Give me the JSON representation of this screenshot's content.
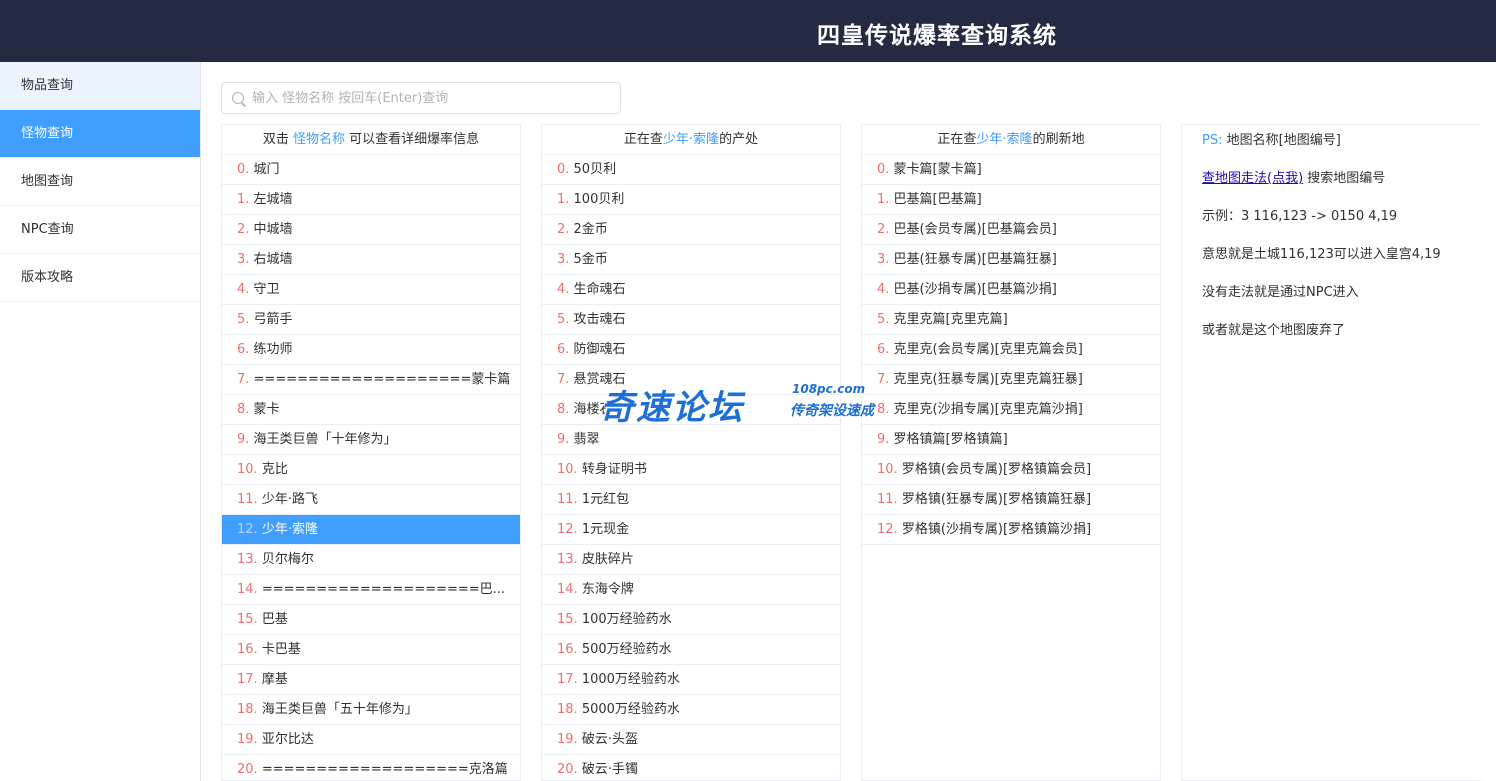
{
  "header": {
    "title": "四皇传说爆率查询系统"
  },
  "sidebar": {
    "items": [
      {
        "label": "物品查询"
      },
      {
        "label": "怪物查询"
      },
      {
        "label": "地图查询"
      },
      {
        "label": "NPC查询"
      },
      {
        "label": "版本攻略"
      }
    ],
    "active_index": 1
  },
  "search": {
    "placeholder": "输入 怪物名称 按回车(Enter)查询",
    "value": ""
  },
  "monster_panel": {
    "head_prefix": "双击 ",
    "head_highlight": "怪物名称",
    "head_suffix": " 可以查看详细爆率信息",
    "selected_index": 12,
    "rows": [
      {
        "idx": "0.",
        "text": " 城门"
      },
      {
        "idx": "1.",
        "text": " 左城墙"
      },
      {
        "idx": "2.",
        "text": " 中城墙"
      },
      {
        "idx": "3.",
        "text": " 右城墙"
      },
      {
        "idx": "4.",
        "text": " 守卫"
      },
      {
        "idx": "5.",
        "text": " 弓箭手"
      },
      {
        "idx": "6.",
        "text": " 练功师"
      },
      {
        "idx": "7.",
        "text": " ====================蒙卡篇"
      },
      {
        "idx": "8.",
        "text": " 蒙卡"
      },
      {
        "idx": "9.",
        "text": " 海王类巨兽「十年修为」"
      },
      {
        "idx": "10.",
        "text": " 克比"
      },
      {
        "idx": "11.",
        "text": " 少年·路飞"
      },
      {
        "idx": "12.",
        "text": " 少年·索隆"
      },
      {
        "idx": "13.",
        "text": " 贝尔梅尔"
      },
      {
        "idx": "14.",
        "text": " ====================巴..."
      },
      {
        "idx": "15.",
        "text": " 巴基"
      },
      {
        "idx": "16.",
        "text": " 卡巴基"
      },
      {
        "idx": "17.",
        "text": " 摩基"
      },
      {
        "idx": "18.",
        "text": " 海王类巨兽「五十年修为」"
      },
      {
        "idx": "19.",
        "text": " 亚尔比达"
      },
      {
        "idx": "20.",
        "text": " ===================克洛篇"
      }
    ]
  },
  "drops_panel": {
    "head_prefix": "正在查",
    "head_highlight": "少年·索隆",
    "head_suffix": "的产处",
    "rows": [
      {
        "idx": "0.",
        "text": " 50贝利"
      },
      {
        "idx": "1.",
        "text": " 100贝利"
      },
      {
        "idx": "2.",
        "text": " 2金币"
      },
      {
        "idx": "3.",
        "text": " 5金币"
      },
      {
        "idx": "4.",
        "text": " 生命魂石"
      },
      {
        "idx": "5.",
        "text": " 攻击魂石"
      },
      {
        "idx": "6.",
        "text": " 防御魂石"
      },
      {
        "idx": "7.",
        "text": " 悬赏魂石"
      },
      {
        "idx": "8.",
        "text": " 海楼石"
      },
      {
        "idx": "9.",
        "text": " 翡翠"
      },
      {
        "idx": "10.",
        "text": " 转身证明书"
      },
      {
        "idx": "11.",
        "text": " 1元红包"
      },
      {
        "idx": "12.",
        "text": " 1元现金"
      },
      {
        "idx": "13.",
        "text": " 皮肤碎片"
      },
      {
        "idx": "14.",
        "text": " 东海令牌"
      },
      {
        "idx": "15.",
        "text": " 100万经验药水"
      },
      {
        "idx": "16.",
        "text": " 500万经验药水"
      },
      {
        "idx": "17.",
        "text": " 1000万经验药水"
      },
      {
        "idx": "18.",
        "text": " 5000万经验药水"
      },
      {
        "idx": "19.",
        "text": " 破云·头盔"
      },
      {
        "idx": "20.",
        "text": " 破云·手镯"
      }
    ]
  },
  "maps_panel": {
    "head_prefix": "正在查",
    "head_highlight": "少年·索隆",
    "head_suffix": "的刷新地",
    "rows": [
      {
        "idx": "0.",
        "text": " 蒙卡篇[蒙卡篇]"
      },
      {
        "idx": "1.",
        "text": " 巴基篇[巴基篇]"
      },
      {
        "idx": "2.",
        "text": " 巴基(会员专属)[巴基篇会员]"
      },
      {
        "idx": "3.",
        "text": " 巴基(狂暴专属)[巴基篇狂暴]"
      },
      {
        "idx": "4.",
        "text": " 巴基(沙捐专属)[巴基篇沙捐]"
      },
      {
        "idx": "5.",
        "text": " 克里克篇[克里克篇]"
      },
      {
        "idx": "6.",
        "text": " 克里克(会员专属)[克里克篇会员]"
      },
      {
        "idx": "7.",
        "text": " 克里克(狂暴专属)[克里克篇狂暴]"
      },
      {
        "idx": "8.",
        "text": " 克里克(沙捐专属)[克里克篇沙捐]"
      },
      {
        "idx": "9.",
        "text": " 罗格镇篇[罗格镇篇]"
      },
      {
        "idx": "10.",
        "text": " 罗格镇(会员专属)[罗格镇篇会员]"
      },
      {
        "idx": "11.",
        "text": " 罗格镇(狂暴专属)[罗格镇篇狂暴]"
      },
      {
        "idx": "12.",
        "text": " 罗格镇(沙捐专属)[罗格镇篇沙捐]"
      }
    ]
  },
  "ps_panel": {
    "label": "PS:",
    "line1": " 地图名称[地图编号]",
    "link": "查地图走法(点我)",
    "link_suffix": " 搜索地图编号",
    "example": "示例：3 116,123 -> 0150 4,19",
    "meaning": "意思就是土城116,123可以进入皇宫4,19",
    "no_route": "没有走法就是通过NPC进入",
    "abandoned": "或者就是这个地图废弃了"
  },
  "watermark": {
    "main": "奇速论坛",
    "url": "108pc.com",
    "sub": "传奇架设速成"
  },
  "colors": {
    "header_bg": "#232a42",
    "accent": "#409eff",
    "index": "#f56c6c"
  }
}
